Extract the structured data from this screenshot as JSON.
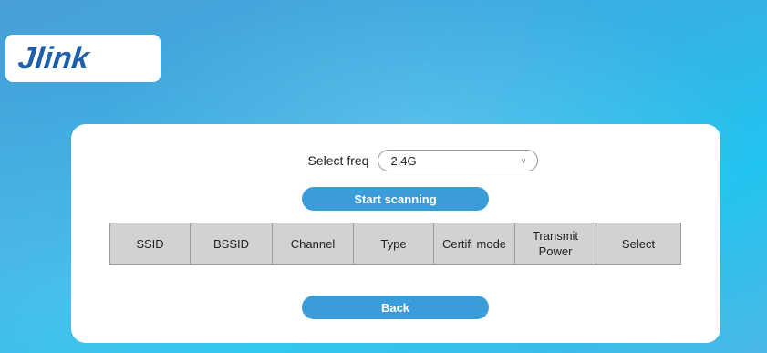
{
  "logo": {
    "text": "Jlink"
  },
  "frequency": {
    "label": "Select freq",
    "selected": "2.4G"
  },
  "buttons": {
    "scan": "Start scanning",
    "back": "Back"
  },
  "table": {
    "columns": [
      "SSID",
      "BSSID",
      "Channel",
      "Type",
      "Certifi mode",
      "Transmit Power",
      "Select"
    ],
    "rows": []
  },
  "colors": {
    "button": "#3a9cd8",
    "header_bg": "#d2d2d2",
    "logo": "#1f5fa8"
  }
}
